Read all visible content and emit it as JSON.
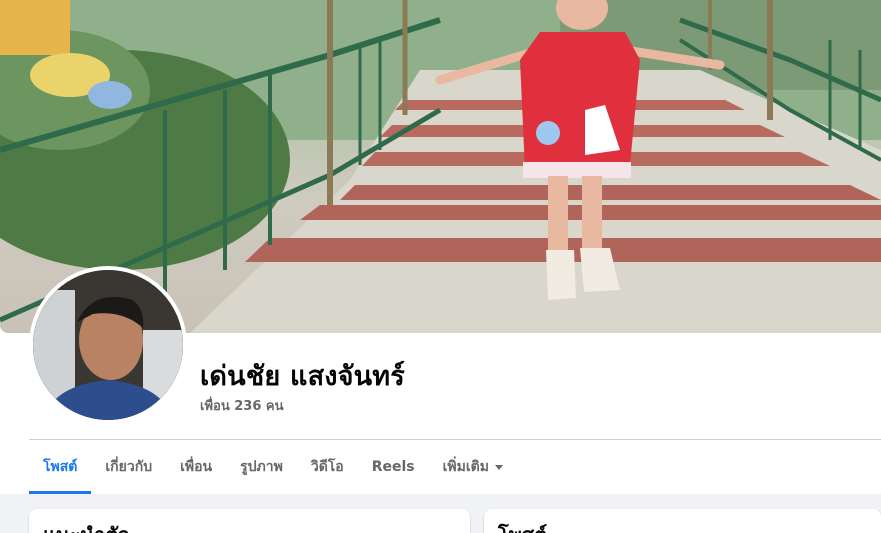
{
  "profile": {
    "name": "เด่นชัย แสงจันทร์",
    "friends": "เพื่อน 236 คน"
  },
  "tabs": [
    {
      "label": "โพสต์",
      "active": true
    },
    {
      "label": "เกี่ยวกับ",
      "active": false
    },
    {
      "label": "เพื่อน",
      "active": false
    },
    {
      "label": "รูปภาพ",
      "active": false
    },
    {
      "label": "วิดีโอ",
      "active": false
    },
    {
      "label": "Reels",
      "active": false
    },
    {
      "label": "เพิ่มเติม",
      "active": false
    }
  ],
  "cards": {
    "intro_title": "แนะนำตัว",
    "posts_title": "โพสต์"
  },
  "colors": {
    "accent": "#1877f2",
    "muted": "#65676b",
    "background": "#f0f2f5"
  },
  "icons": {
    "more_tab": "caret-down-icon"
  }
}
